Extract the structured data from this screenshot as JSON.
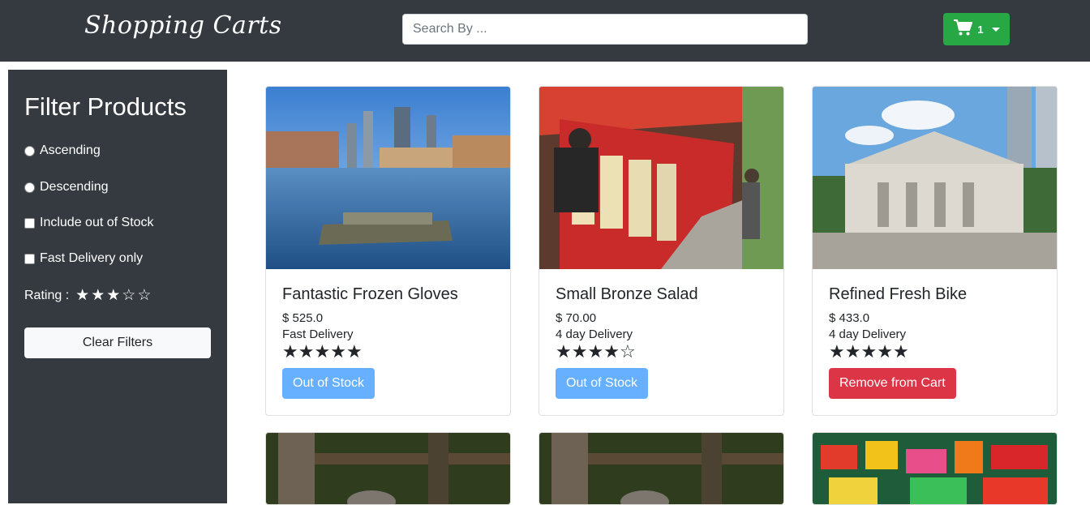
{
  "header": {
    "brand": "Shopping Carts",
    "search_placeholder": "Search By ...",
    "cart_count": "1"
  },
  "filters": {
    "title": "Filter Products",
    "ascending": "Ascending",
    "descending": "Descending",
    "include_oos": "Include out of Stock",
    "fast_delivery": "Fast Delivery only",
    "rating_label": "Rating :",
    "rating_value": 3,
    "rating_max": 5,
    "clear_label": "Clear Filters"
  },
  "products": [
    {
      "name": "Fantastic Frozen Gloves",
      "price": "$ 525.0",
      "delivery": "Fast Delivery",
      "rating": 5,
      "action": "Out of Stock",
      "action_type": "oos"
    },
    {
      "name": "Small Bronze Salad",
      "price": "$ 70.00",
      "delivery": "4 day Delivery",
      "rating": 4,
      "action": "Out of Stock",
      "action_type": "oos"
    },
    {
      "name": "Refined Fresh Bike",
      "price": "$ 433.0",
      "delivery": "4 day Delivery",
      "rating": 5,
      "action": "Remove from Cart",
      "action_type": "remove"
    }
  ],
  "colors": {
    "navbar": "#343a40",
    "cart_button": "#28a745",
    "out_of_stock": "#66b0ff",
    "remove": "#dc3545"
  },
  "icons": {
    "cart": "shopping-cart-icon",
    "star_filled": "★",
    "star_empty": "☆"
  }
}
